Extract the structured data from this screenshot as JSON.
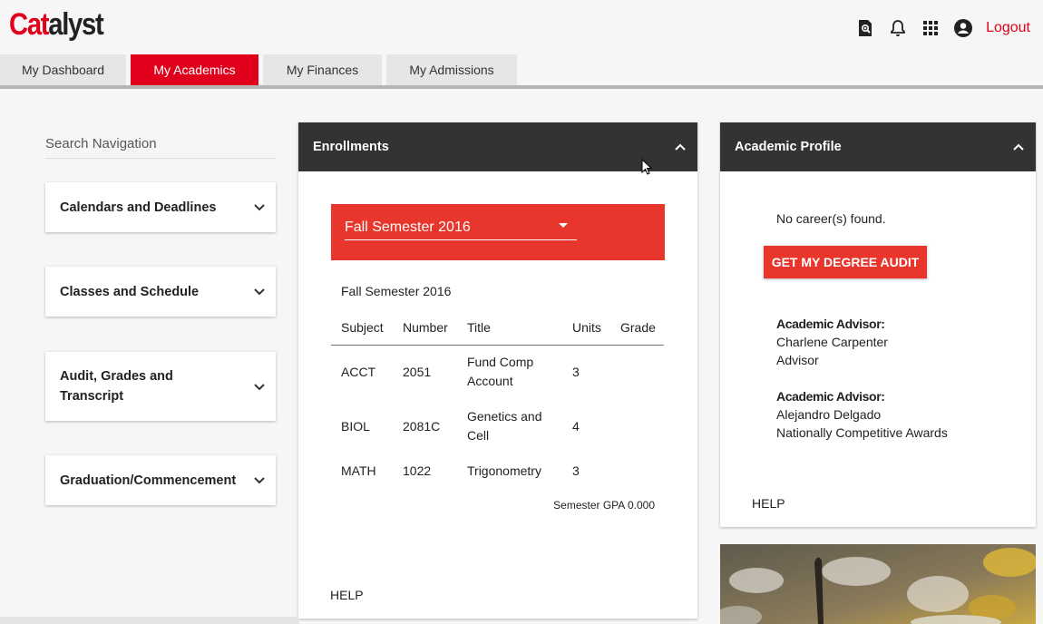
{
  "app": {
    "logo_red": "Cat",
    "logo_black": "alyst",
    "logout_label": "Logout"
  },
  "header_icons": [
    "search-document-icon",
    "bell-icon",
    "apps-grid-icon",
    "account-icon"
  ],
  "tabs": [
    {
      "label": "My Dashboard",
      "active": false
    },
    {
      "label": "My Academics",
      "active": true
    },
    {
      "label": "My Finances",
      "active": false
    },
    {
      "label": "My Admissions",
      "active": false
    }
  ],
  "sidebar": {
    "search_label": "Search Navigation",
    "items": [
      {
        "label": "Calendars and Deadlines"
      },
      {
        "label": "Classes and Schedule"
      },
      {
        "label": "Audit, Grades and Transcript"
      },
      {
        "label": "Graduation/Commencement"
      }
    ]
  },
  "enrollments": {
    "title": "Enrollments",
    "term_selected": "Fall Semester 2016",
    "term_caption": "Fall Semester 2016",
    "columns": [
      "Subject",
      "Number",
      "Title",
      "Units",
      "Grade"
    ],
    "rows": [
      {
        "subject": "ACCT",
        "number": "2051",
        "title": "Fund Comp Account",
        "units": "3",
        "grade": ""
      },
      {
        "subject": "BIOL",
        "number": "2081C",
        "title": "Genetics and Cell",
        "units": "4",
        "grade": ""
      },
      {
        "subject": "MATH",
        "number": "1022",
        "title": "Trigonometry",
        "units": "3",
        "grade": ""
      }
    ],
    "gpa_text": "Semester GPA 0.000",
    "help_label": "HELP"
  },
  "profile": {
    "title": "Academic Profile",
    "no_career": "No career(s) found.",
    "audit_button": "GET MY DEGREE AUDIT",
    "advisors": [
      {
        "label": "Academic Advisor:",
        "name": "Charlene Carpenter",
        "role": "Advisor"
      },
      {
        "label": "Academic Advisor:",
        "name": "Alejandro Delgado",
        "role": "Nationally Competitive Awards"
      }
    ],
    "help_label": "HELP"
  },
  "colors": {
    "brand_red": "#e0001b",
    "term_red": "#e8362c",
    "panel_header": "#333333"
  }
}
